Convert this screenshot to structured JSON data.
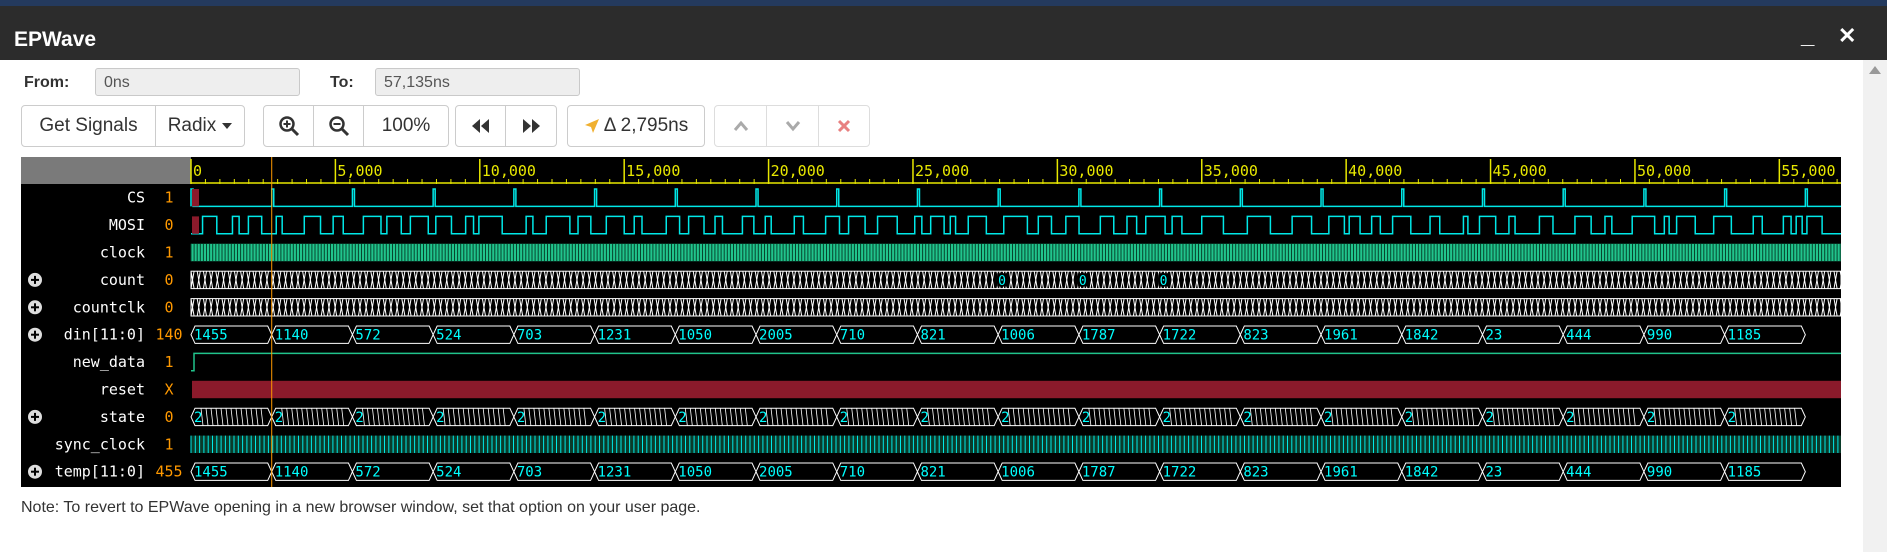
{
  "window": {
    "title": "EPWave",
    "minimize_glyph": "_",
    "close_glyph": "✕"
  },
  "range": {
    "from_label": "From:",
    "from_value": "0ns",
    "to_label": "To:",
    "to_value": "57,135ns"
  },
  "toolbar": {
    "get_signals": "Get Signals",
    "radix": "Radix",
    "zoom_level": "100%",
    "delta": "Δ 2,795ns",
    "icons": [
      "zoom-in-icon",
      "zoom-out-icon",
      "rewind-icon",
      "fast-forward-icon",
      "cursor-arrow-icon",
      "chevron-up-icon",
      "chevron-down-icon",
      "delete-x-icon"
    ]
  },
  "timeline": {
    "ticks": [
      "0",
      "5,000",
      "10,000",
      "15,000",
      "20,000",
      "25,000",
      "30,000",
      "35,000",
      "40,000",
      "45,000",
      "50,000",
      "55,000"
    ],
    "max_ns": 57135,
    "cursor_ns": 2795
  },
  "colors": {
    "background": "#000000",
    "wave": "#00e8e8",
    "clock": "#21c48c",
    "hex_text": "#00ffff",
    "value": "#ff9900",
    "reset": "#8b1a2b",
    "ruler": "#e8e800",
    "cursor": "#ff9900"
  },
  "signals": [
    {
      "name": "CS",
      "value": "1",
      "expandable": false,
      "kind": "bit"
    },
    {
      "name": "MOSI",
      "value": "0",
      "expandable": false,
      "kind": "bit"
    },
    {
      "name": "clock",
      "value": "1",
      "expandable": false,
      "kind": "clock"
    },
    {
      "name": "count",
      "value": "0",
      "expandable": true,
      "kind": "dense",
      "labels": [
        "0",
        "0",
        "0"
      ]
    },
    {
      "name": "countclk",
      "value": "0",
      "expandable": true,
      "kind": "dense",
      "labels": []
    },
    {
      "name": "din[11:0]",
      "value": "140",
      "expandable": true,
      "kind": "bus",
      "labels": [
        "1455",
        "1140",
        "572",
        "524",
        "703",
        "1231",
        "1050",
        "2005",
        "710",
        "821",
        "1006",
        "1787",
        "1722",
        "823",
        "1961",
        "1842",
        "23",
        "444",
        "990",
        "1185"
      ]
    },
    {
      "name": "new_data",
      "value": "1",
      "expandable": false,
      "kind": "high"
    },
    {
      "name": "reset",
      "value": "X",
      "expandable": false,
      "kind": "x"
    },
    {
      "name": "state",
      "value": "0",
      "expandable": true,
      "kind": "statebus",
      "labels": [
        "2",
        "2",
        "2",
        "2",
        "2",
        "2",
        "2",
        "2",
        "2",
        "2",
        "2",
        "2",
        "2",
        "2",
        "2",
        "2",
        "2",
        "2",
        "2",
        "2"
      ]
    },
    {
      "name": "sync_clock",
      "value": "1",
      "expandable": false,
      "kind": "sync"
    },
    {
      "name": "temp[11:0]",
      "value": "455",
      "expandable": true,
      "kind": "bus",
      "labels": [
        "1455",
        "1140",
        "572",
        "524",
        "703",
        "1231",
        "1050",
        "2005",
        "710",
        "821",
        "1006",
        "1787",
        "1722",
        "823",
        "1961",
        "1842",
        "23",
        "444",
        "990",
        "1185"
      ]
    }
  ],
  "note": "Note: To revert to EPWave opening in a new browser window, set that option on your user page."
}
